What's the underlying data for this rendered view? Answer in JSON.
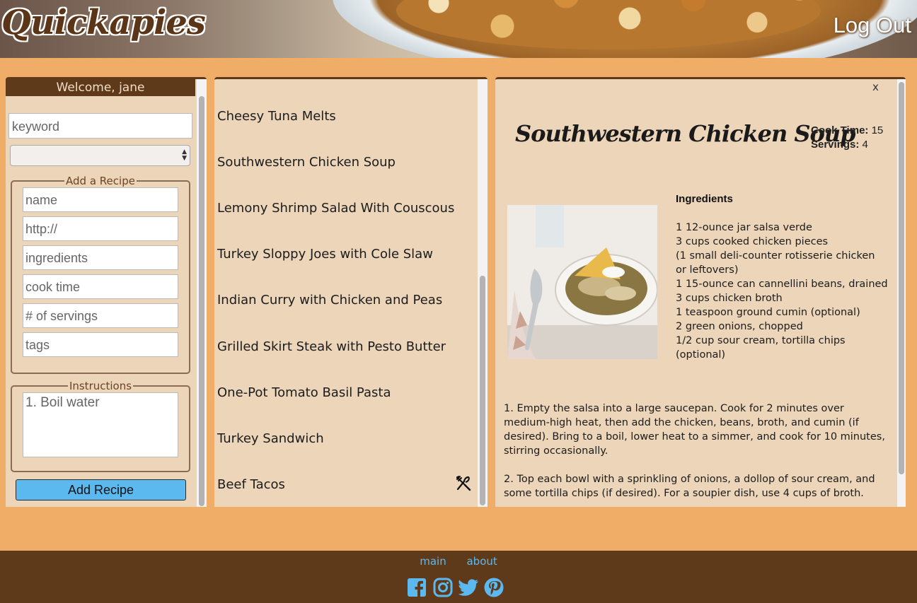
{
  "header": {
    "logo": "Quickapies",
    "logout_label": "Log Out"
  },
  "sidebar": {
    "welcome": "Welcome, jane",
    "keyword_placeholder": "keyword",
    "add_recipe_legend": "Add a Recipe",
    "fields": {
      "name": "name",
      "url": "http://",
      "ingredients": "ingredients",
      "cook_time": "cook time",
      "servings": "# of servings",
      "tags": "tags"
    },
    "instructions_legend": "Instructions",
    "instructions_placeholder": "1. Boil water",
    "add_button": "Add Recipe"
  },
  "recipe_list": [
    "Cheesy Tuna Melts",
    "Southwestern Chicken Soup",
    "Lemony Shrimp Salad With Couscous",
    "Turkey Sloppy Joes with Cole Slaw",
    "Indian Curry with Chicken and Peas",
    "Grilled Skirt Steak with Pesto Butter",
    "One-Pot Tomato Basil Pasta",
    "Turkey Sandwich",
    "Beef Tacos"
  ],
  "detail": {
    "close": "x",
    "title": "Southwestern Chicken Soup",
    "cook_time_label": "Cook Time:",
    "cook_time": "15",
    "servings_label": "Servings:",
    "servings": "4",
    "ingredients_heading": "Ingredients",
    "ingredients": [
      "1 12-ounce jar salsa verde",
      "3 cups cooked chicken pieces",
      "(1 small deli-counter rotisserie chicken or leftovers)",
      "1 15-ounce can cannellini beans, drained",
      "3 cups chicken broth",
      "1 teaspoon ground cumin (optional)",
      "2 green onions, chopped",
      "1/2 cup sour cream, tortilla chips (optional)"
    ],
    "instructions": [
      "1. Empty the salsa into a large saucepan. Cook for 2 minutes over medium-high heat, then add the chicken, beans, broth, and cumin (if desired). Bring to a boil, lower heat to a simmer, and cook for 10 minutes, stirring occasionally.",
      "2. Top each bowl with a sprinkling of onions, a dollop of sour cream, and some tortilla chips (if desired). For a soupier dish, use 4 cups of broth."
    ]
  },
  "footer": {
    "links": [
      "main",
      "about"
    ],
    "social_icons": [
      "facebook-icon",
      "instagram-icon",
      "twitter-icon",
      "pinterest-icon"
    ],
    "link_color": "#5bb9f0"
  },
  "colors": {
    "background": "#efad67",
    "panel": "#ecd5b9",
    "brown": "#5e3a1a",
    "button": "#5bb9f0"
  }
}
